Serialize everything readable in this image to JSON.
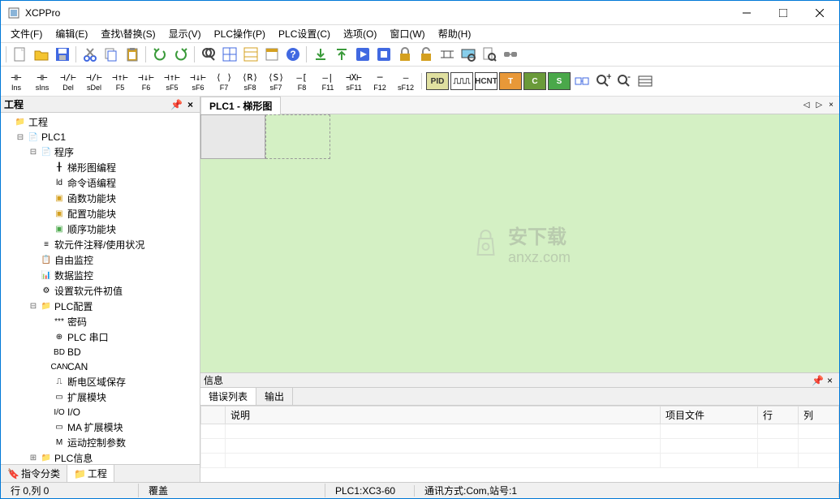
{
  "window": {
    "title": "XCPPro"
  },
  "menu": [
    "文件(F)",
    "编辑(E)",
    "查找\\替换(S)",
    "显示(V)",
    "PLC操作(P)",
    "PLC设置(C)",
    "选项(O)",
    "窗口(W)",
    "帮助(H)"
  ],
  "toolbar1_icons": [
    "new",
    "open",
    "save",
    "cut",
    "copy",
    "paste",
    "undo",
    "redo",
    "find",
    "grid",
    "ladder",
    "block",
    "help",
    "download",
    "upload",
    "run",
    "stop",
    "lock",
    "unlock",
    "ladder-tool",
    "monitor",
    "preview",
    "connect"
  ],
  "ladder_buttons": [
    {
      "sym": "⊣⊢",
      "lbl": "Ins"
    },
    {
      "sym": "⊣⊢",
      "lbl": "sIns"
    },
    {
      "sym": "⊣/⊢",
      "lbl": "Del"
    },
    {
      "sym": "⊣/⊢",
      "lbl": "sDel"
    },
    {
      "sym": "⊣↑⊢",
      "lbl": "F5"
    },
    {
      "sym": "⊣↓⊢",
      "lbl": "F6"
    },
    {
      "sym": "⊣↑⊢",
      "lbl": "sF5"
    },
    {
      "sym": "⊣↓⊢",
      "lbl": "sF6"
    },
    {
      "sym": "⟨ ⟩",
      "lbl": "F7"
    },
    {
      "sym": "⟨R⟩",
      "lbl": "sF8"
    },
    {
      "sym": "⟨S⟩",
      "lbl": "sF7"
    },
    {
      "sym": "—[",
      "lbl": "F8"
    },
    {
      "sym": "—|",
      "lbl": "F11"
    },
    {
      "sym": "⊣X⊢",
      "lbl": "sF11"
    },
    {
      "sym": "─",
      "lbl": "F12"
    },
    {
      "sym": "—",
      "lbl": "sF12"
    }
  ],
  "badge_buttons": [
    {
      "txt": "PID",
      "bg": "#e0e0a0"
    },
    {
      "txt": "⎍⎍⎍",
      "bg": "#fff"
    },
    {
      "txt": "HCNT",
      "bg": "#fff"
    },
    {
      "txt": "T",
      "bg": "#e89838"
    },
    {
      "txt": "C",
      "bg": "#6a9a3a"
    },
    {
      "txt": "S",
      "bg": "#4aa84a"
    }
  ],
  "sidebar": {
    "title": "工程",
    "root": "工程",
    "plc": "PLC1",
    "items": [
      {
        "indent": 2,
        "toggle": "⊟",
        "icon": "📄",
        "label": "程序"
      },
      {
        "indent": 3,
        "toggle": "",
        "icon": "╂",
        "label": "梯形图编程"
      },
      {
        "indent": 3,
        "toggle": "",
        "icon": "ld",
        "label": "命令语编程"
      },
      {
        "indent": 3,
        "toggle": "",
        "icon": "▣",
        "label": "函数功能块",
        "color": "#d4a020"
      },
      {
        "indent": 3,
        "toggle": "",
        "icon": "▣",
        "label": "配置功能块",
        "color": "#d4a020"
      },
      {
        "indent": 3,
        "toggle": "",
        "icon": "▣",
        "label": "顺序功能块",
        "color": "#4aa84a"
      },
      {
        "indent": 2,
        "toggle": "",
        "icon": "≡",
        "label": "软元件注释/使用状况"
      },
      {
        "indent": 2,
        "toggle": "",
        "icon": "📋",
        "label": "自由监控"
      },
      {
        "indent": 2,
        "toggle": "",
        "icon": "📊",
        "label": "数据监控"
      },
      {
        "indent": 2,
        "toggle": "",
        "icon": "⚙",
        "label": "设置软元件初值"
      },
      {
        "indent": 2,
        "toggle": "⊟",
        "icon": "📁",
        "label": "PLC配置"
      },
      {
        "indent": 3,
        "toggle": "",
        "icon": "***",
        "label": "密码"
      },
      {
        "indent": 3,
        "toggle": "",
        "icon": "⊕",
        "label": "PLC 串口"
      },
      {
        "indent": 3,
        "toggle": "",
        "icon": "BD",
        "label": "BD"
      },
      {
        "indent": 3,
        "toggle": "",
        "icon": "CAN",
        "label": "CAN"
      },
      {
        "indent": 3,
        "toggle": "",
        "icon": "⎍",
        "label": "断电区域保存"
      },
      {
        "indent": 3,
        "toggle": "",
        "icon": "▭",
        "label": "扩展模块"
      },
      {
        "indent": 3,
        "toggle": "",
        "icon": "I/O",
        "label": "I/O"
      },
      {
        "indent": 3,
        "toggle": "",
        "icon": "▭",
        "label": "MA 扩展模块"
      },
      {
        "indent": 3,
        "toggle": "",
        "icon": "M",
        "label": "运动控制参数"
      },
      {
        "indent": 2,
        "toggle": "⊞",
        "icon": "📁",
        "label": "PLC信息"
      }
    ],
    "tabs": [
      "指令分类",
      "工程"
    ]
  },
  "doc_tab": "PLC1 - 梯形图",
  "info": {
    "title": "信息",
    "tabs": [
      "错误列表",
      "输出"
    ],
    "columns": [
      "",
      "说明",
      "项目文件",
      "行",
      "列"
    ]
  },
  "statusbar": {
    "pos": "行 0,列 0",
    "mode": "覆盖",
    "plc": "PLC1:XC3-60",
    "comm": "通讯方式:Com,站号:1"
  },
  "watermark": {
    "text1": "安下载",
    "text2": "anxz.com"
  }
}
